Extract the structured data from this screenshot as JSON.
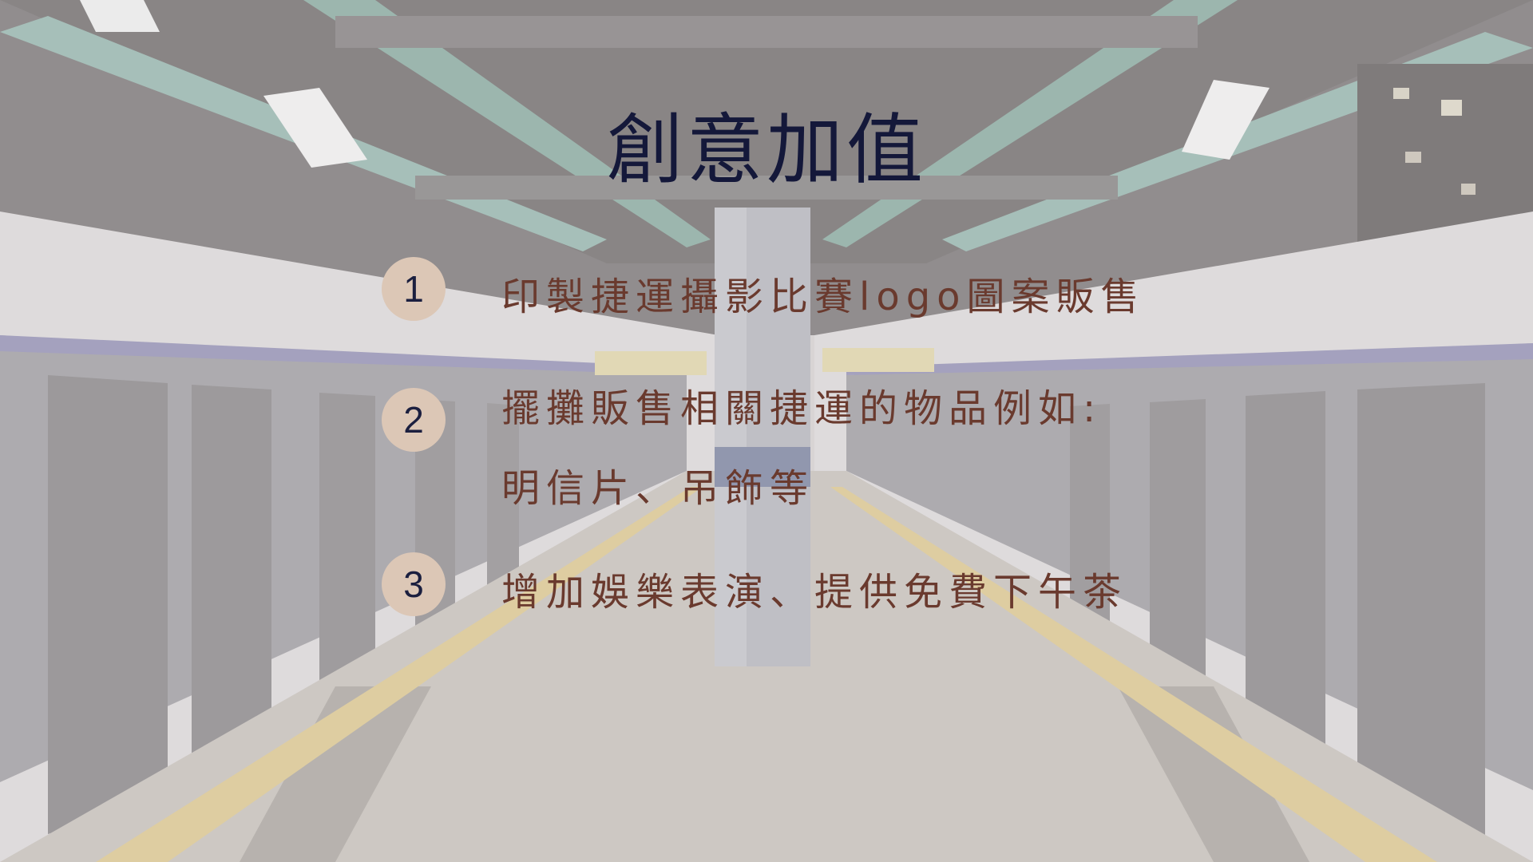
{
  "slide": {
    "title": "創意加值",
    "items": [
      {
        "number": "1",
        "lines": [
          "印製捷運攝影比賽logo圖案販售"
        ]
      },
      {
        "number": "2",
        "lines": [
          "擺攤販售相關捷運的物品例如:",
          "明信片、吊飾等"
        ]
      },
      {
        "number": "3",
        "lines": [
          "增加娛樂表演、提供免費下午茶"
        ]
      }
    ]
  },
  "colors": {
    "title": "#14183a",
    "body_text": "#6a3a2e",
    "badge_fill": "#dcc7b6",
    "badge_text": "#1b1f3f"
  }
}
